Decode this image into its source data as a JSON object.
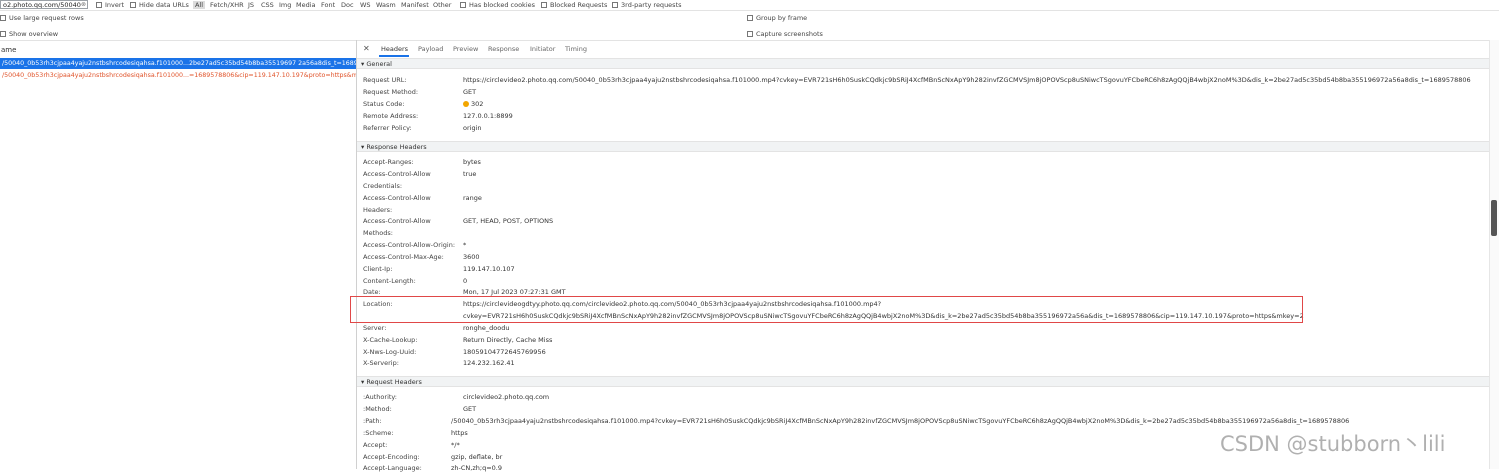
{
  "filter_bar": {
    "input_value": "o2.photo.qq.com/50040",
    "invert_label": "Invert",
    "hide_data_urls_label": "Hide data URLs",
    "types": [
      "All",
      "Fetch/XHR",
      "JS",
      "CSS",
      "Img",
      "Media",
      "Font",
      "Doc",
      "WS",
      "Wasm",
      "Manifest",
      "Other"
    ],
    "selected_type": "All",
    "has_blocked_cookies_label": "Has blocked cookies",
    "blocked_requests_label": "Blocked Requests",
    "third_party_label": "3rd-party requests"
  },
  "options": {
    "use_large_rows": "Use large request rows",
    "show_overview": "Show overview",
    "group_by_frame": "Group by frame",
    "capture_screenshots": "Capture screenshots"
  },
  "request_list": {
    "name_header": "ame",
    "rows": [
      {
        "text": "/50040_0b53rh3cjpaa4yaju2nstbshrcodesiqahsa.f101000...2be27ad5c35bd54b8ba35519697 2a56a8dis_t=1689..."
      },
      {
        "text": "/50040_0b53rh3cjpaa4yaju2nstbshrcodesiqahsa.f101000...=1689578806&cip=119.147.10.197&proto=https&mk..."
      }
    ]
  },
  "tabs": {
    "close": "✕",
    "items": [
      "Headers",
      "Payload",
      "Preview",
      "Response",
      "Initiator",
      "Timing"
    ],
    "active": "Headers"
  },
  "general": {
    "title": "▾ General",
    "rows": [
      {
        "k": "Request URL:",
        "v": "https://circlevideo2.photo.qq.com/50040_0b53rh3cjpaa4yaju2nstbshrcodesiqahsa.f101000.mp4?cvkey=EVR721sH6h0SuskCQdkjc9bSRiJ4XcfMBnScNxApY9h282invfZGCMVSJm8jOPOVScp8uSNiwcTSgovuYFCbeRC6h8zAgQQjB4wbjX2noM%3D&dis_k=2be27ad5c35bd54b8ba355196972a56a8dis_t=1689578806"
      },
      {
        "k": "Request Method:",
        "v": "GET"
      },
      {
        "k": "Status Code:",
        "v": "302"
      },
      {
        "k": "Remote Address:",
        "v": "127.0.0.1:8899"
      },
      {
        "k": "Referrer Policy:",
        "v": "origin"
      }
    ]
  },
  "response_headers": {
    "title": "▾ Response Headers",
    "rows": [
      {
        "k": "Accept-Ranges:",
        "v": "bytes"
      },
      {
        "k": "Access-Control-Allow",
        "v": "true"
      },
      {
        "k": "Credentials:",
        "v": ""
      },
      {
        "k": "Access-Control-Allow",
        "v": "range"
      },
      {
        "k": "Headers:",
        "v": ""
      },
      {
        "k": "Access-Control-Allow",
        "v": "GET, HEAD, POST, OPTIONS"
      },
      {
        "k": "Methods:",
        "v": ""
      },
      {
        "k": "Access-Control-Allow-Origin:",
        "v": "*"
      },
      {
        "k": "Access-Control-Max-Age:",
        "v": "3600"
      },
      {
        "k": "Client-Ip:",
        "v": "119.147.10.107"
      },
      {
        "k": "Content-Length:",
        "v": "0"
      },
      {
        "k": "Date:",
        "v": "Mon, 17 Jul 2023 07:27:31 GMT"
      },
      {
        "k": "Location:",
        "v": "https://circlevideogdtyy.photo.qq.com/circlevideo2.photo.qq.com/50040_0b53rh3cjpaa4yaju2nstbshrcodesiqahsa.f101000.mp4?"
      },
      {
        "k": "",
        "v": "cvkey=EVR721sH6h0SuskCQdkjc9bSRiJ4XcfMBnScNxApY9h282invfZGCMVSJm8jOPOVScp8uSNiwcTSgovuYFCbeRC6h8zAgQQjB4wbjX2noM%3D&dis_k=2be27ad5c35bd54b8ba355196972a56a&dis_t=1689578806&cip=119.147.10.197&proto=https&mkey=2"
      },
      {
        "k": "Server:",
        "v": "ronghe_doodu"
      },
      {
        "k": "X-Cache-Lookup:",
        "v": "Return Directly, Cache Miss"
      },
      {
        "k": "X-Nws-Log-Uuid:",
        "v": "18059104772645769956"
      },
      {
        "k": "X-Serverip:",
        "v": "124.232.162.41"
      }
    ]
  },
  "request_headers": {
    "title": "▾ Request Headers",
    "rows": [
      {
        "k": ":Authority:",
        "v": "circlevideo2.photo.qq.com"
      },
      {
        "k": ":Method:",
        "v": "GET"
      },
      {
        "k": ":Path:",
        "v": "/50040_0b53rh3cjpaa4yaju2nstbshrcodesiqahsa.f101000.mp4?cvkey=EVR721sH6h0SuskCQdkjc9bSRiJ4XcfMBnScNxApY9h282invfZGCMVSJm8jOPOVScp8uSNiwcTSgovuYFCbeRC6h8zAgQQjB4wbjX2noM%3D&dis_k=2be27ad5c35bd54b8ba355196972a56a8dis_t=1689578806"
      },
      {
        "k": ":Scheme:",
        "v": "https"
      },
      {
        "k": "Accept:",
        "v": "*/*"
      },
      {
        "k": "Accept-Encoding:",
        "v": "gzip, deflate, br"
      },
      {
        "k": "Accept-Language:",
        "v": "zh-CN,zh;q=0.9"
      }
    ]
  },
  "watermark": "CSDN @stubborn丶lili",
  "colors": {
    "selected_row": "#1a73e8",
    "error_text": "#e0532a",
    "highlight_box": "#e04848",
    "status_dot": "#f2a600"
  }
}
